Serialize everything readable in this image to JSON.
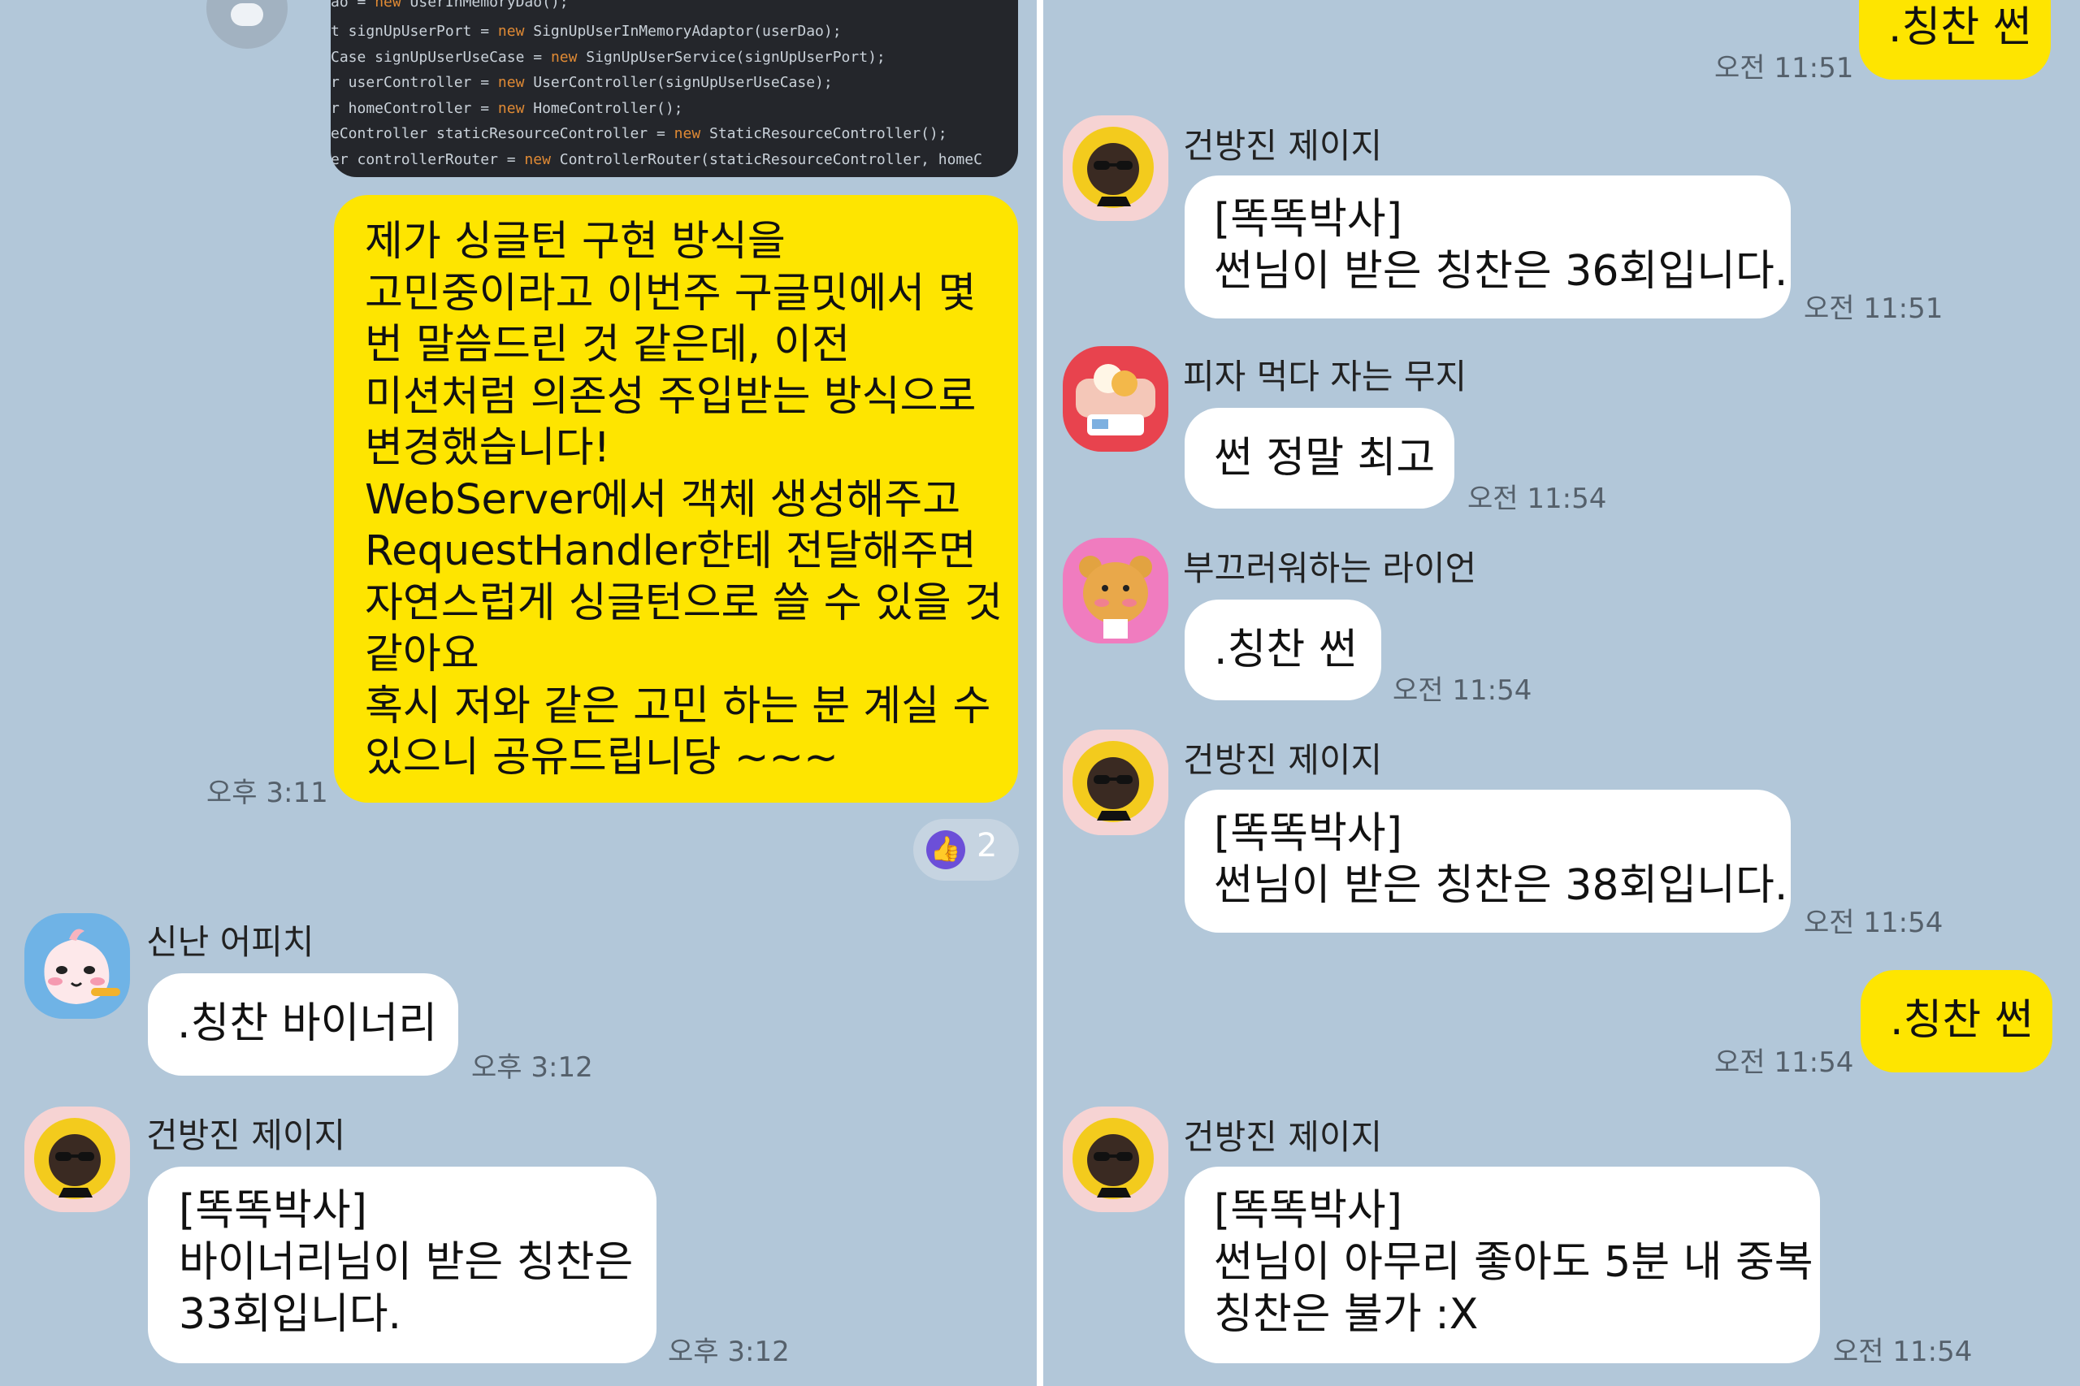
{
  "left": {
    "code_lines": [
      {
        "pre": "ao = ",
        "kw": "new",
        "post": " UserInMemoryDao();"
      },
      {
        "pre": "t signUpUserPort = ",
        "kw": "new",
        "post": " SignUpUserInMemoryAdaptor(userDao);"
      },
      {
        "pre": "Case signUpUserUseCase = ",
        "kw": "new",
        "post": " SignUpUserService(signUpUserPort);"
      },
      {
        "pre": "r userController = ",
        "kw": "new",
        "post": " UserController(signUpUserUseCase);"
      },
      {
        "pre": "r homeController = ",
        "kw": "new",
        "post": " HomeController();"
      },
      {
        "pre": "eController staticResourceController = ",
        "kw": "new",
        "post": " StaticResourceController();"
      },
      {
        "pre": "er controllerRouter = ",
        "kw": "new",
        "post": " ControllerRouter(staticResourceController, homeC"
      }
    ],
    "my_message": {
      "text": "제가 싱글턴 구현 방식을\n고민중이라고 이번주 구글밋에서 몇\n번 말씀드린 것 같은데, 이전\n미션처럼 의존성 주입받는 방식으로\n변경했습니다!\nWebServer에서 객체 생성해주고\nRequestHandler한테 전달해주면\n자연스럽게 싱글턴으로 쓸 수 있을 것\n같아요\n혹시 저와 같은 고민 하는 분 계실 수\n있으니 공유드립니당 ~~~",
      "time": "오후 3:11"
    },
    "reaction": {
      "icon": "thumbs-up-icon",
      "count": "2"
    },
    "messages": [
      {
        "sender": "신난 어피치",
        "avatar": "apeach",
        "text": ".칭찬 바이너리",
        "time": "오후 3:12"
      },
      {
        "sender": "건방진 제이지",
        "avatar": "jayg",
        "text": "[똑똑박사]\n바이너리님이 받은 칭찬은\n33회입니다.",
        "time": "오후 3:12"
      }
    ]
  },
  "right": {
    "my_messages": [
      {
        "text": ".칭찬 썬",
        "time": "오전 11:51"
      },
      {
        "text": ".칭찬 썬",
        "time": "오전 11:54"
      }
    ],
    "messages": [
      {
        "sender": "건방진 제이지",
        "avatar": "jayg",
        "text": "[똑똑박사]\n썬님이 받은 칭찬은 36회입니다.",
        "time": "오전 11:51"
      },
      {
        "sender": "피자 먹다 자는 무지",
        "avatar": "muzi",
        "text": "썬 정말 최고",
        "time": "오전 11:54"
      },
      {
        "sender": "부끄러워하는 라이언",
        "avatar": "ryan",
        "text": ".칭찬 썬",
        "time": "오전 11:54"
      },
      {
        "sender": "건방진 제이지",
        "avatar": "jayg",
        "text": "[똑똑박사]\n썬님이 받은 칭찬은 38회입니다.",
        "time": "오전 11:54"
      },
      {
        "sender": "건방진 제이지",
        "avatar": "jayg",
        "text": "[똑똑박사]\n썬님이 아무리 좋아도 5분 내 중복\n칭찬은 불가 :X",
        "time": "오전 11:54"
      }
    ]
  },
  "colors": {
    "chat_background": "#b2c7d9",
    "my_bubble": "#fee500",
    "other_bubble": "#ffffff",
    "reaction_purple": "#6c4fd8"
  }
}
